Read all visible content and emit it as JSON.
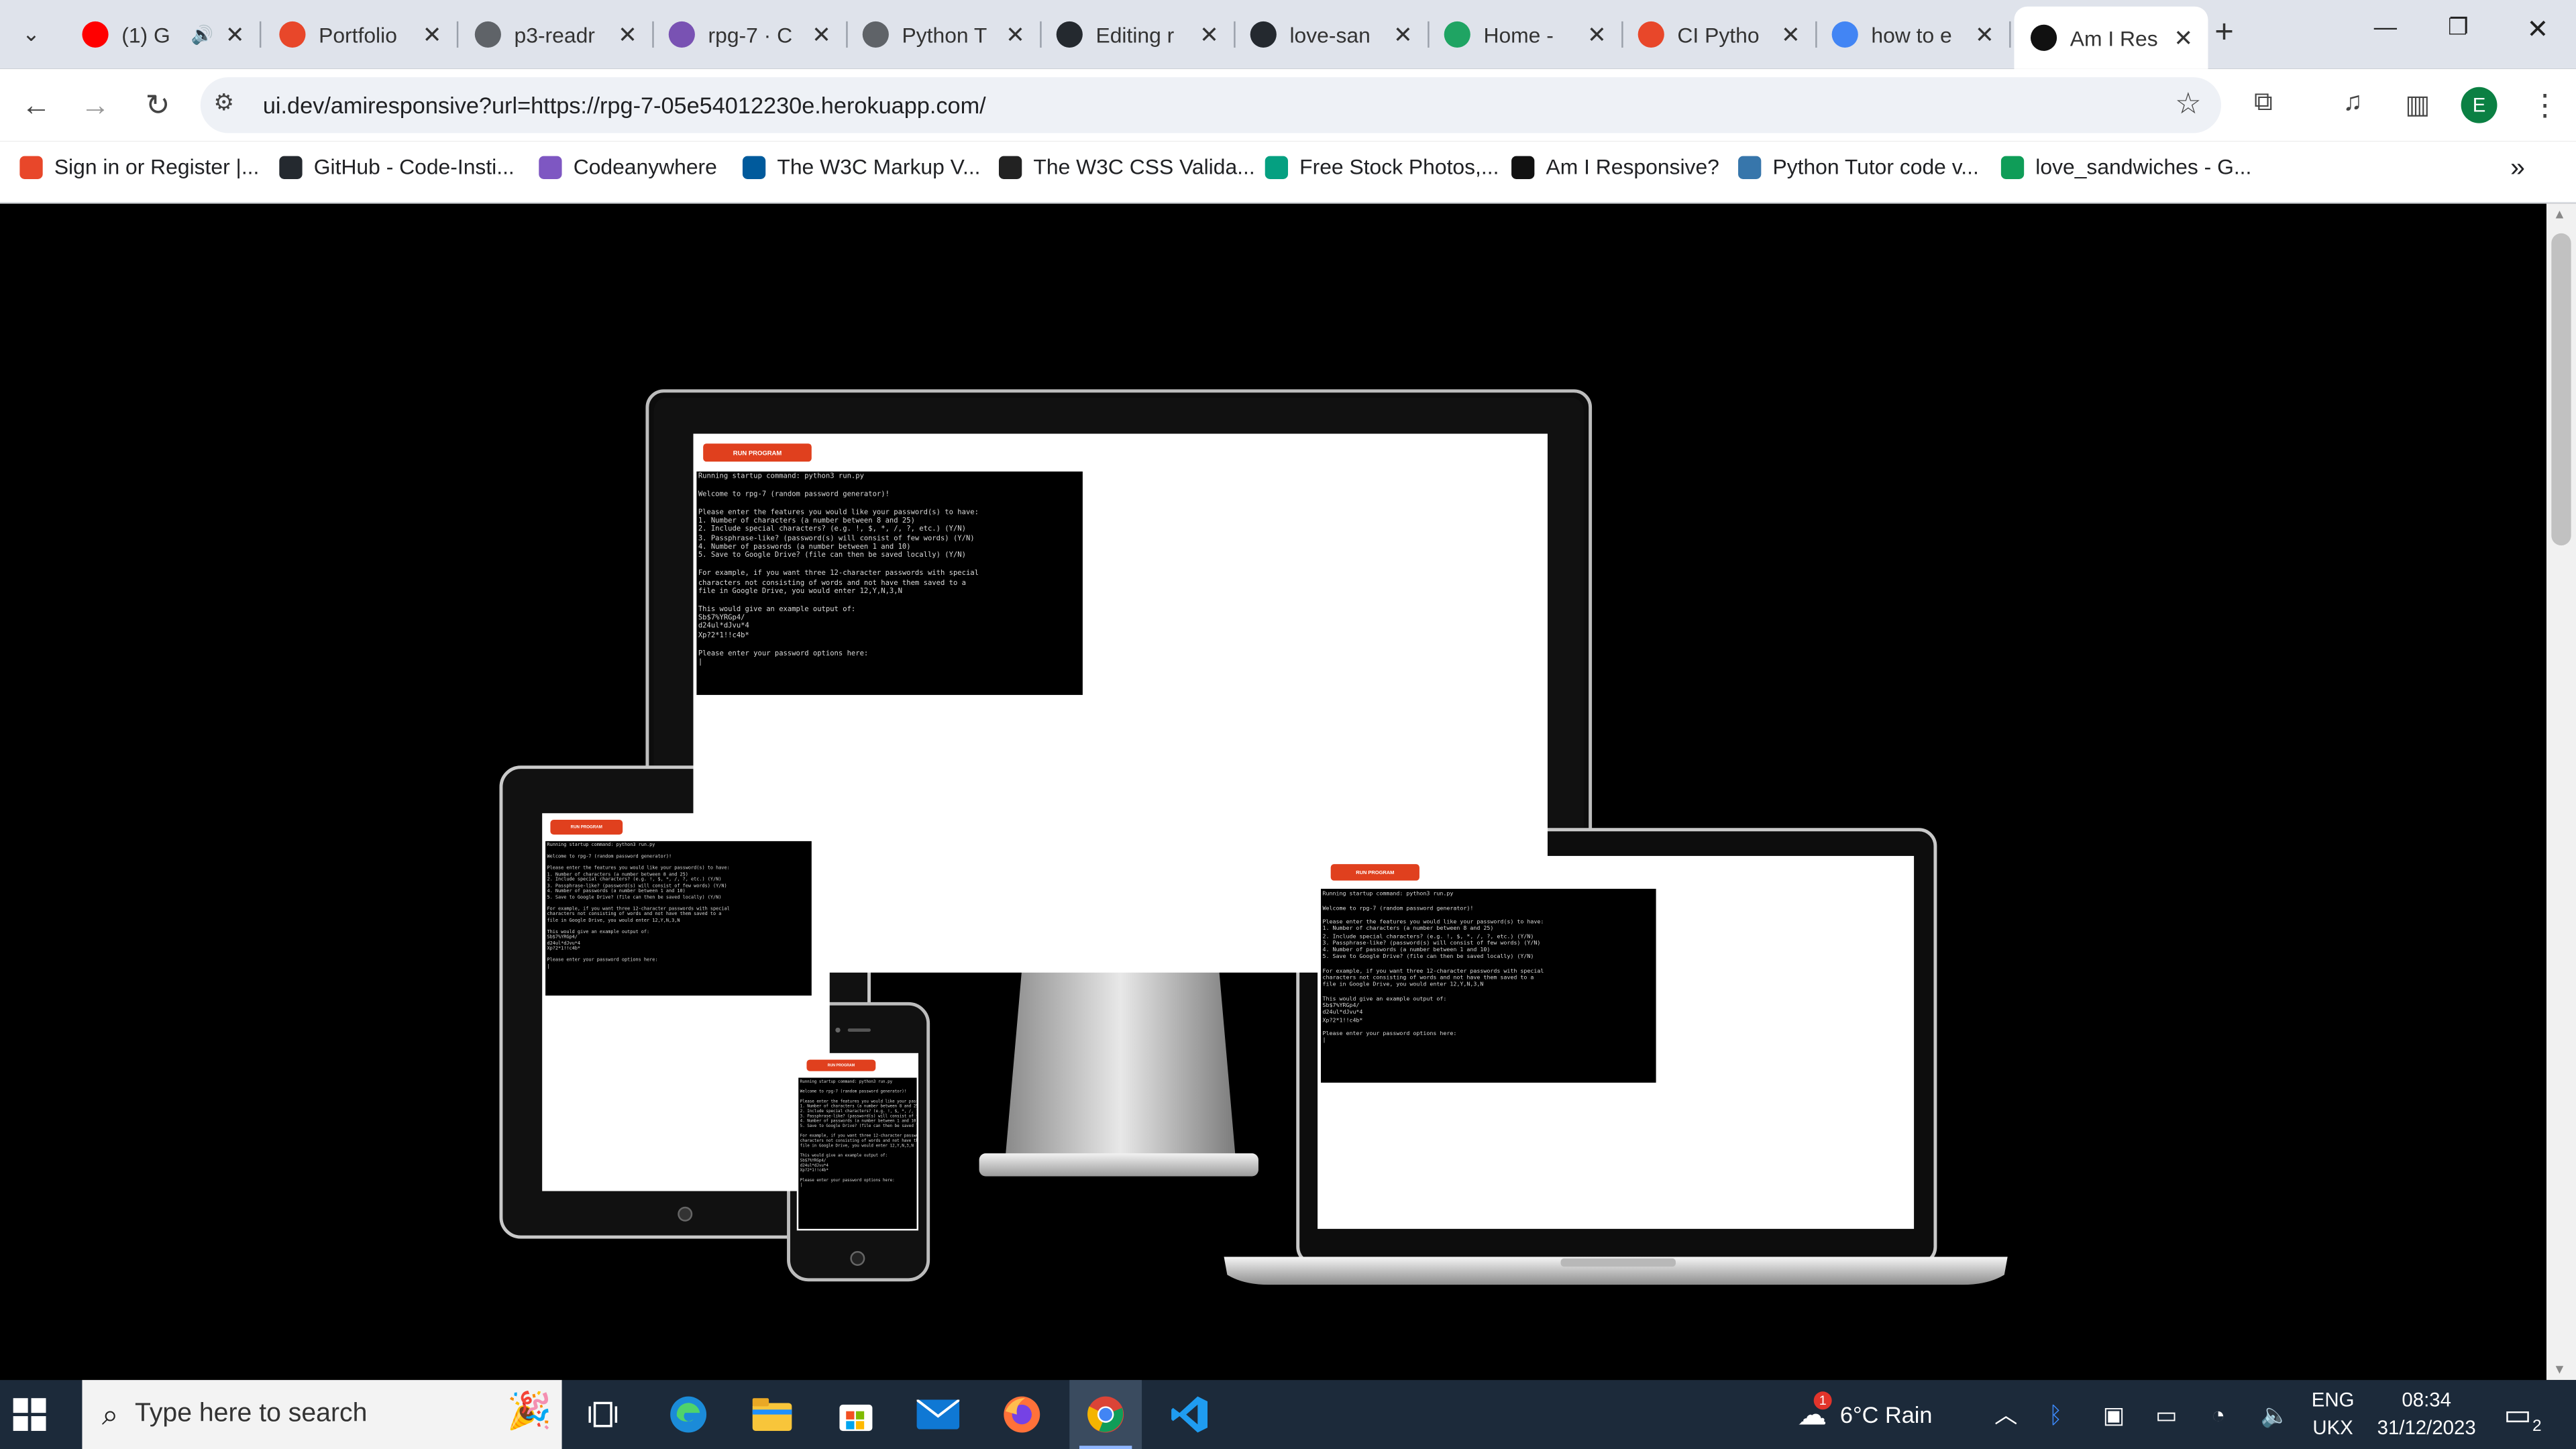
{
  "tabs": [
    {
      "title": "(1) G",
      "favicon": "youtube-icon",
      "color": "#ff0000",
      "audio": true
    },
    {
      "title": "Portfolio",
      "favicon": "ci-icon",
      "color": "#e8472a"
    },
    {
      "title": "p3-readr",
      "favicon": "globe-icon",
      "color": "#5f6368"
    },
    {
      "title": "rpg-7 · C",
      "favicon": "heroku-icon",
      "color": "#7952b3"
    },
    {
      "title": "Python T",
      "favicon": "globe-icon",
      "color": "#5f6368"
    },
    {
      "title": "Editing r",
      "favicon": "github-icon",
      "color": "#24292f"
    },
    {
      "title": "love-san",
      "favicon": "github-icon",
      "color": "#24292f"
    },
    {
      "title": "Home -",
      "favicon": "drive-icon",
      "color": "#1fa463"
    },
    {
      "title": "CI Pytho",
      "favicon": "ci-icon",
      "color": "#e8472a"
    },
    {
      "title": "how to e",
      "favicon": "google-icon",
      "color": "#4285f4"
    },
    {
      "title": "Am I Res",
      "favicon": "amiresponsive-icon",
      "color": "#111111",
      "active": true
    }
  ],
  "browser": {
    "url": "ui.dev/amiresponsive?url=https://rpg-7-05e54012230e.herokuapp.com/",
    "profile_initial": "E"
  },
  "bookmarks": [
    {
      "label": "Sign in or Register |...",
      "icon": "ci-icon",
      "color": "#e8472a"
    },
    {
      "label": "GitHub - Code-Insti...",
      "icon": "github-icon",
      "color": "#24292f"
    },
    {
      "label": "Codeanywhere",
      "icon": "codeanywhere-icon",
      "color": "#7e57c2"
    },
    {
      "label": "The W3C Markup V...",
      "icon": "w3c-icon",
      "color": "#005a9c"
    },
    {
      "label": "The W3C CSS Valida...",
      "icon": "w3c-css-icon",
      "color": "#222222"
    },
    {
      "label": "Free Stock Photos,...",
      "icon": "pexels-icon",
      "color": "#05a081"
    },
    {
      "label": "Am I Responsive?",
      "icon": "amiresponsive-icon",
      "color": "#111111"
    },
    {
      "label": "Python Tutor code v...",
      "icon": "python-icon",
      "color": "#3776ab"
    },
    {
      "label": "love_sandwiches - G...",
      "icon": "sheets-icon",
      "color": "#0f9d58"
    }
  ],
  "app": {
    "run_button": "RUN PROGRAM",
    "terminal_lines": [
      "Running startup command: python3 run.py",
      "",
      "Welcome to rpg-7 (random password generator)!",
      "",
      "Please enter the features you would like your password(s) to have:",
      "1. Number of characters (a number between 8 and 25)",
      "2. Include special characters? (e.g. !, $, *, /, ?, etc.) (Y/N)",
      "3. Passphrase-like? (password(s) will consist of few words) (Y/N)",
      "4. Number of passwords (a number between 1 and 10)",
      "5. Save to Google Drive? (file can then be saved locally) (Y/N)",
      "",
      "For example, if you want three 12-character passwords with special",
      "characters not consisting of words and not have them saved to a",
      "file in Google Drive, you would enter 12,Y,N,3,N",
      "",
      "This would give an example output of:",
      "Sb$7%YRGp4/",
      "d24ul*dJvu*4",
      "Xp?2*1!!c4b*",
      "",
      "Please enter your password options here:",
      "|"
    ]
  },
  "taskbar": {
    "search_placeholder": "Type here to search",
    "weather": "6°C  Rain",
    "lang_top": "ENG",
    "lang_bottom": "UKX",
    "time": "08:34",
    "date": "31/12/2023",
    "notifications": "2",
    "weather_badge": "1"
  }
}
